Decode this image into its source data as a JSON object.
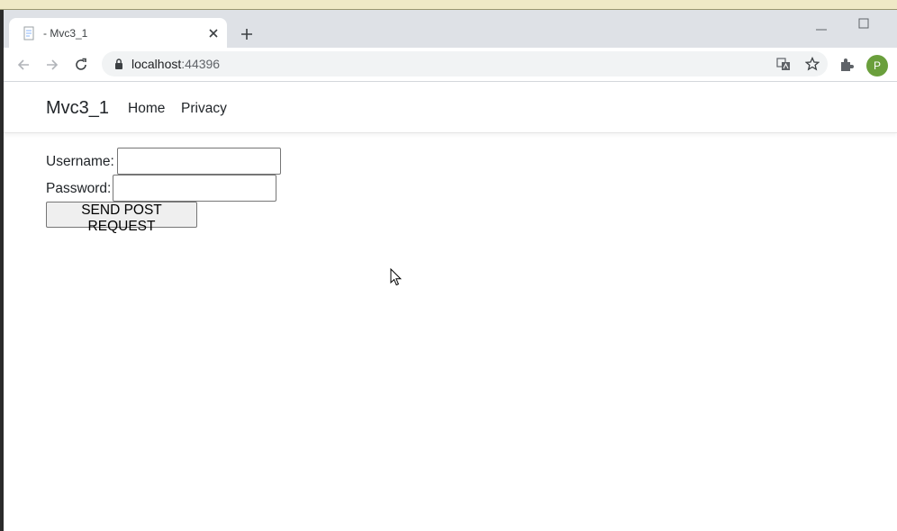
{
  "browser": {
    "tab": {
      "title": "- Mvc3_1"
    },
    "address": {
      "host": "localhost",
      "port": ":44396"
    },
    "avatar_initial": "P",
    "icons": [
      "back-icon",
      "forward-icon",
      "reload-icon",
      "lock-icon",
      "translate-icon",
      "star-icon",
      "extensions-icon",
      "new-tab-icon",
      "close-icon",
      "minimize-icon",
      "maximize-icon"
    ]
  },
  "navbar": {
    "brand": "Mvc3_1",
    "links": [
      "Home",
      "Privacy"
    ]
  },
  "form": {
    "username_label": "Username:",
    "username_value": "",
    "password_label": "Password:",
    "password_value": "",
    "submit_label": "SEND POST REQUEST"
  },
  "colors": {
    "tabbar": "#dee1e6",
    "avatar": "#6a9f3c",
    "text": "#212529"
  }
}
